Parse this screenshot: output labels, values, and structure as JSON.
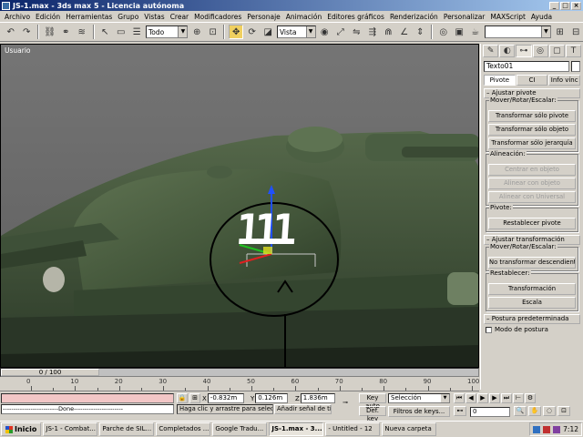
{
  "window": {
    "title": "JS-1.max - 3ds max 5 - Licencia autónoma",
    "buttons": [
      "_",
      "□",
      "×"
    ]
  },
  "menu": [
    "Archivo",
    "Edición",
    "Herramientas",
    "Grupo",
    "Vistas",
    "Crear",
    "Modificadores",
    "Personaje",
    "Animación",
    "Editores gráficos",
    "Renderización",
    "Personalizar",
    "MAXScript",
    "Ayuda"
  ],
  "toolbar": {
    "filter": "Todo",
    "coord_system": "Vista"
  },
  "viewport": {
    "label": "Usuario",
    "decal_text": "111"
  },
  "command_panel": {
    "tabs": [
      "create-icon",
      "modify-icon",
      "hierarchy-icon",
      "motion-icon",
      "display-icon",
      "utilities-icon"
    ],
    "object_name": "Texto01",
    "sub_tabs": [
      "Pivote",
      "CI",
      "Info vínc"
    ],
    "adjust_pivot": {
      "title": "Ajustar pivote",
      "move_group": "Mover/Rotar/Escalar:",
      "buttons": [
        "Transformar sólo pivote",
        "Transformar sólo objeto",
        "Transformar sólo jerarquía"
      ],
      "align_group": "Alineación:",
      "align_buttons": [
        "Centrar en objeto",
        "Alinear con objeto",
        "Alinear con Universal"
      ],
      "pivot_group": "Pivote:",
      "reset_button": "Restablecer pivote"
    },
    "adjust_transform": {
      "title": "Ajustar transformación",
      "move_group": "Mover/Rotar/Escalar:",
      "button": "No transformar descendientes",
      "reset_group": "Restablecer:",
      "reset_buttons": [
        "Transformación",
        "Escala"
      ]
    },
    "preferred_pose": {
      "title": "Postura predeterminada",
      "checkbox": "Modo de postura"
    }
  },
  "timeline": {
    "slider_label": "0 / 100",
    "ticks": [
      0,
      10,
      20,
      30,
      40,
      50,
      60,
      70,
      80,
      90,
      100
    ]
  },
  "status": {
    "maxscript_output": "--------------------------Done-----------------------",
    "prompt": "Haga clic y arrastre para seleccionar",
    "add_tag": "Añadir señal de tiempo",
    "x": "-0.832m",
    "y": "0.126m",
    "z": "1.836m",
    "key_auto": "Key auto",
    "key_set": "Def. key",
    "selection": "Selección",
    "filters": "Filtros de keys...",
    "frame": "0"
  },
  "taskbar": {
    "start": "Inicio",
    "tasks": [
      "JS-1 - Combat...",
      "Parche de SIL...",
      "Completados ...",
      "Google Tradu...",
      "JS-1.max - 3...",
      "- Untitled - 12",
      "Nueva carpeta"
    ],
    "active_task": 4,
    "clock": "7:12"
  }
}
